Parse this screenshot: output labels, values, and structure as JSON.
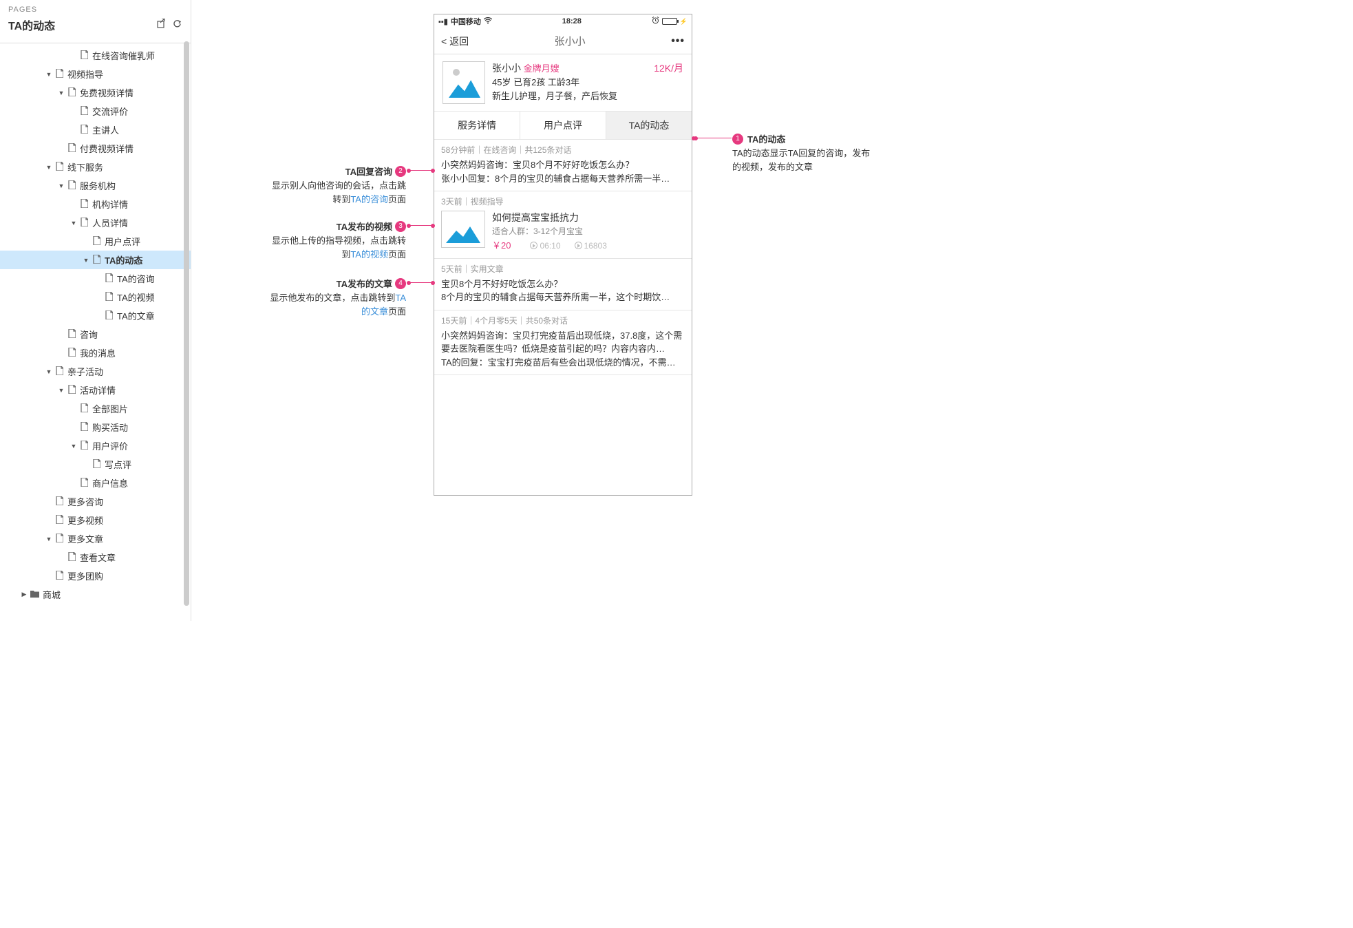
{
  "sidebar": {
    "pages_label": "PAGES",
    "title": "TA的动态",
    "tree": [
      {
        "indent": 5,
        "toggle": "",
        "icon": "page",
        "label": "在线咨询催乳师"
      },
      {
        "indent": 3,
        "toggle": "▼",
        "icon": "page",
        "label": "视频指导"
      },
      {
        "indent": 4,
        "toggle": "▼",
        "icon": "page",
        "label": "免费视频详情"
      },
      {
        "indent": 5,
        "toggle": "",
        "icon": "page",
        "label": "交流评价"
      },
      {
        "indent": 5,
        "toggle": "",
        "icon": "page",
        "label": "主讲人"
      },
      {
        "indent": 4,
        "toggle": "",
        "icon": "page",
        "label": "付费视频详情"
      },
      {
        "indent": 3,
        "toggle": "▼",
        "icon": "page",
        "label": "线下服务"
      },
      {
        "indent": 4,
        "toggle": "▼",
        "icon": "page",
        "label": "服务机构"
      },
      {
        "indent": 5,
        "toggle": "",
        "icon": "page",
        "label": "机构详情"
      },
      {
        "indent": 5,
        "toggle": "▼",
        "icon": "page",
        "label": "人员详情"
      },
      {
        "indent": 6,
        "toggle": "",
        "icon": "page",
        "label": "用户点评"
      },
      {
        "indent": 6,
        "toggle": "▼",
        "icon": "page",
        "label": "TA的动态",
        "selected": true
      },
      {
        "indent": 7,
        "toggle": "",
        "icon": "page",
        "label": "TA的咨询"
      },
      {
        "indent": 7,
        "toggle": "",
        "icon": "page",
        "label": "TA的视频"
      },
      {
        "indent": 7,
        "toggle": "",
        "icon": "page",
        "label": "TA的文章"
      },
      {
        "indent": 4,
        "toggle": "",
        "icon": "page",
        "label": "咨询"
      },
      {
        "indent": 4,
        "toggle": "",
        "icon": "page",
        "label": "我的消息"
      },
      {
        "indent": 3,
        "toggle": "▼",
        "icon": "page",
        "label": "亲子活动"
      },
      {
        "indent": 4,
        "toggle": "▼",
        "icon": "page",
        "label": "活动详情"
      },
      {
        "indent": 5,
        "toggle": "",
        "icon": "page",
        "label": "全部图片"
      },
      {
        "indent": 5,
        "toggle": "",
        "icon": "page",
        "label": "购买活动"
      },
      {
        "indent": 5,
        "toggle": "▼",
        "icon": "page",
        "label": "用户评价"
      },
      {
        "indent": 6,
        "toggle": "",
        "icon": "page",
        "label": "写点评"
      },
      {
        "indent": 5,
        "toggle": "",
        "icon": "page",
        "label": "商户信息"
      },
      {
        "indent": 3,
        "toggle": "",
        "icon": "page",
        "label": "更多咨询"
      },
      {
        "indent": 3,
        "toggle": "",
        "icon": "page",
        "label": "更多视频"
      },
      {
        "indent": 3,
        "toggle": "▼",
        "icon": "page",
        "label": "更多文章"
      },
      {
        "indent": 4,
        "toggle": "",
        "icon": "page",
        "label": "查看文章"
      },
      {
        "indent": 3,
        "toggle": "",
        "icon": "page",
        "label": "更多团购"
      },
      {
        "indent": 1,
        "toggle": "▶",
        "icon": "folder",
        "label": "商城"
      }
    ]
  },
  "phone": {
    "carrier": "中国移动",
    "time": "18:28",
    "nav_back": "返回",
    "nav_title": "张小小",
    "nav_more": "•••",
    "profile": {
      "name": "张小小",
      "badge": "金牌月嫂",
      "price": "12K/月",
      "line2": "45岁  已育2孩    工龄3年",
      "line3": "新生儿护理，月子餐，产后恢复"
    },
    "tabs": [
      "服务详情",
      "用户点评",
      "TA的动态"
    ],
    "feed": [
      {
        "meta": "58分钟前｜在线咨询｜共125条对话",
        "line1": "小突然妈妈咨询：宝贝8个月不好好吃饭怎么办？",
        "line2": "张小小回复：8个月的宝贝的辅食占据每天营养所需一半…"
      },
      {
        "meta": "3天前｜视频指导",
        "video": {
          "title": "如何提高宝宝抵抗力",
          "sub": "适合人群：3-12个月宝宝",
          "price": "￥20",
          "duration": "06:10",
          "views": "16803"
        }
      },
      {
        "meta": "5天前｜实用文章",
        "line1": "宝贝8个月不好好吃饭怎么办？",
        "line2": "8个月的宝贝的辅食占据每天营养所需一半，这个时期饮…"
      },
      {
        "meta": "15天前｜4个月零5天｜共50条对话",
        "line1": "小突然妈妈咨询：宝贝打完疫苗后出现低烧，37.8度，这个需要去医院看医生吗？低烧是疫苗引起的吗？内容内容内…",
        "line2": "TA的回复：宝宝打完疫苗后有些会出现低烧的情况，不需…"
      }
    ]
  },
  "annotations": {
    "a1": {
      "num": "1",
      "title": "TA的动态",
      "desc": "TA的动态显示TA回复的咨询，发布的视频，发布的文章"
    },
    "a2": {
      "num": "2",
      "title": "TA回复咨询",
      "desc_pre": "显示别人向他咨询的会话，点击跳转到",
      "link": "TA的咨询",
      "desc_post": "页面"
    },
    "a3": {
      "num": "3",
      "title": "TA发布的视频",
      "desc_pre": "显示他上传的指导视频，点击跳转到",
      "link": "TA的视频",
      "desc_post": "页面"
    },
    "a4": {
      "num": "4",
      "title": "TA发布的文章",
      "desc_pre": "显示他发布的文章，点击跳转到",
      "link": "TA的文章",
      "desc_post": "页面"
    }
  }
}
